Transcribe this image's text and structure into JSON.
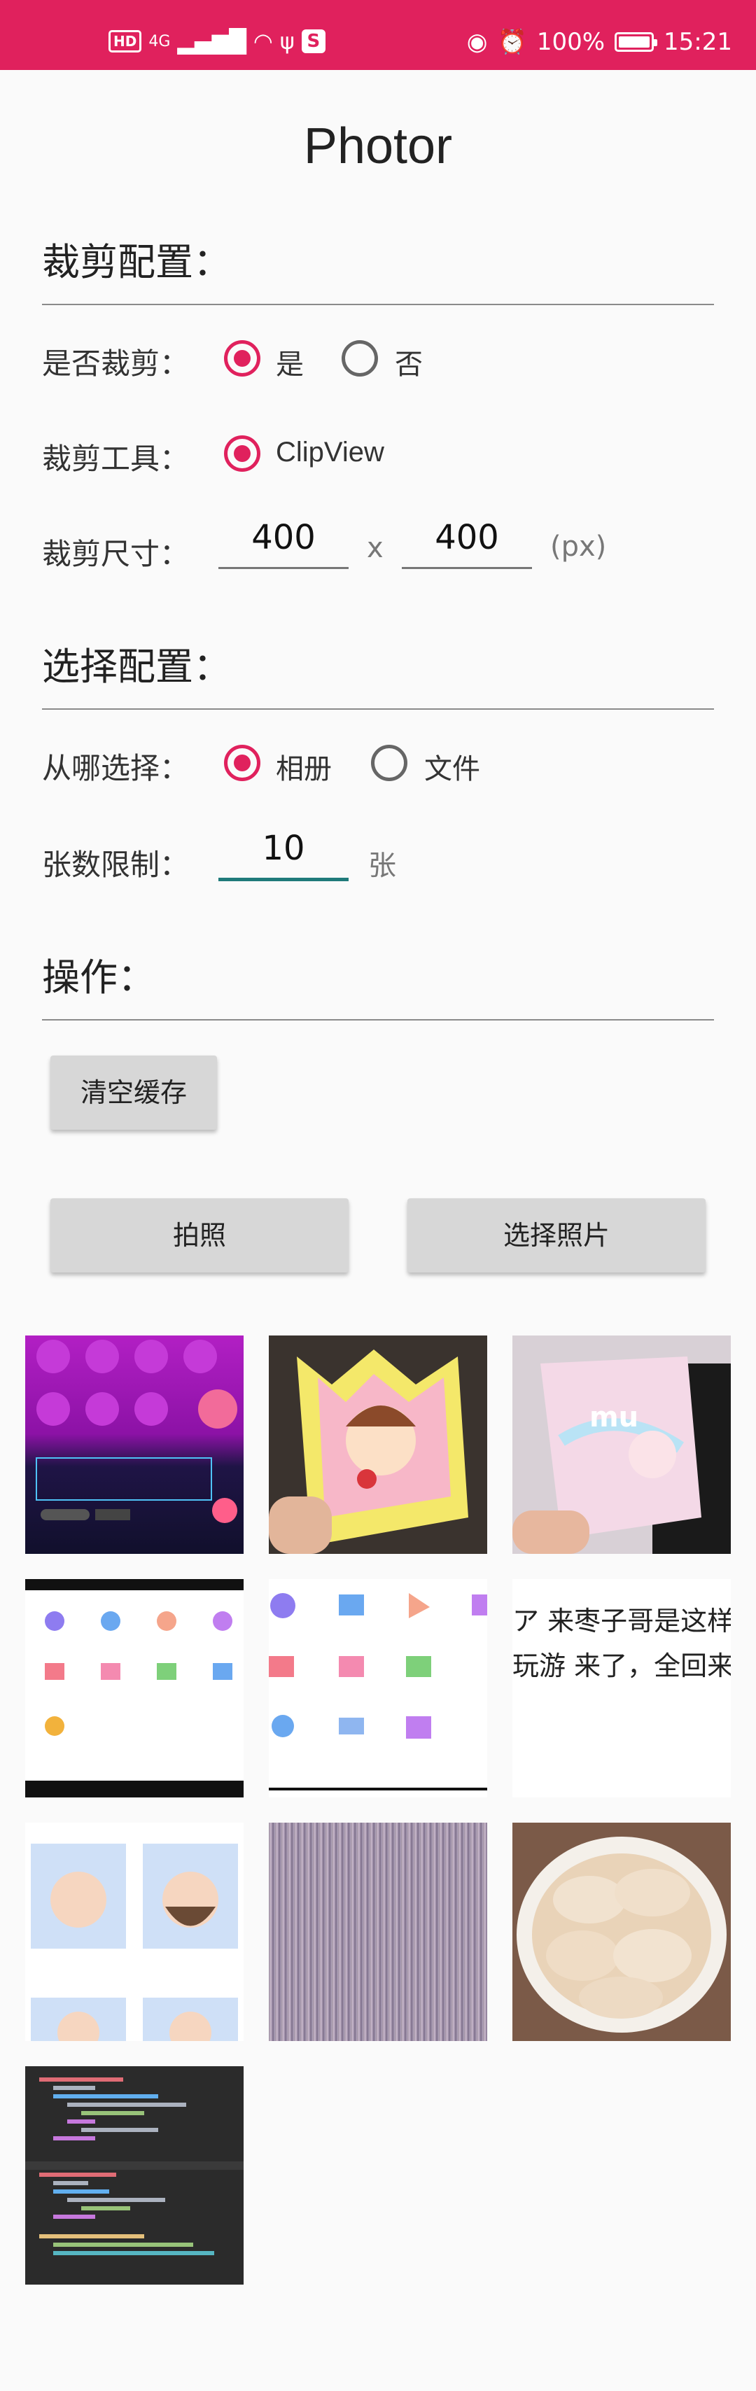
{
  "status_bar": {
    "hd": "HD",
    "network": "4G",
    "battery": "100%",
    "time": "15:21"
  },
  "app": {
    "title": "Photor"
  },
  "crop_config": {
    "header": "裁剪配置：",
    "crop_label": "是否裁剪：",
    "crop_yes": "是",
    "crop_no": "否",
    "tool_label": "裁剪工具：",
    "tool_option": "ClipView",
    "size_label": "裁剪尺寸：",
    "width": "400",
    "times": "x",
    "height": "400",
    "unit": "(px)"
  },
  "select_config": {
    "header": "选择配置：",
    "source_label": "从哪选择：",
    "source_album": "相册",
    "source_file": "文件",
    "limit_label": "张数限制：",
    "limit_value": "10",
    "limit_unit": "张"
  },
  "actions": {
    "header": "操作：",
    "clear_cache": "清空缓存",
    "take_photo": "拍照",
    "choose_photo": "选择照片"
  },
  "thumbnails": [
    {
      "name": "chat-room-screenshot"
    },
    {
      "name": "princess-crown-card"
    },
    {
      "name": "unicorn-gift-box"
    },
    {
      "name": "settings-icons-grid"
    },
    {
      "name": "settings-icons-zoom"
    },
    {
      "name": "chinese-text-snippet",
      "text": "ア 来枣子哥是这样玩 大小虎是这样玩游 来了，全回来了！"
    },
    {
      "name": "avatar-cards"
    },
    {
      "name": "moire-screen-photo"
    },
    {
      "name": "dumplings-bowl"
    },
    {
      "name": "python-code"
    }
  ],
  "colors": {
    "accent": "#e0215d",
    "focus": "#1f7a7a",
    "button": "#d7d7d7"
  }
}
